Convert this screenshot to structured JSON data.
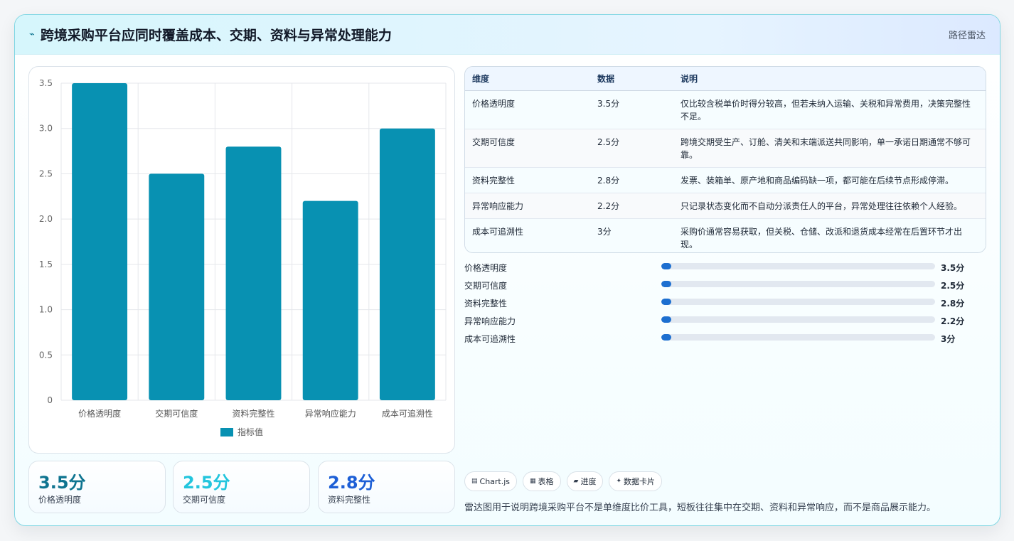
{
  "header": {
    "icon": "sparkline-icon",
    "title": "跨境采购平台应同时覆盖成本、交期、资料与异常处理能力",
    "tag": "路径雷达"
  },
  "chart_data": {
    "type": "bar",
    "categories": [
      "价格透明度",
      "交期可信度",
      "资料完整性",
      "异常响应能力",
      "成本可追溯性"
    ],
    "series": [
      {
        "name": "指标值",
        "values": [
          3.5,
          2.5,
          2.8,
          2.2,
          3.0
        ],
        "color": "#0891b2"
      }
    ],
    "ylim": [
      0,
      3.5
    ],
    "yticks": [
      "0",
      "0.5",
      "1.0",
      "1.5",
      "2.0",
      "2.5",
      "3.0",
      "3.5"
    ],
    "grid": true,
    "legend": "bottom"
  },
  "stats": [
    {
      "value": "3.5分",
      "label": "价格透明度",
      "color": "#0e7490"
    },
    {
      "value": "2.5分",
      "label": "交期可信度",
      "color": "#22c5dd"
    },
    {
      "value": "2.8分",
      "label": "资料完整性",
      "color": "#1d5fd6"
    }
  ],
  "table": {
    "headers": [
      "维度",
      "数据",
      "说明"
    ],
    "rows": [
      [
        "价格透明度",
        "3.5分",
        "仅比较含税单价时得分较高，但若未纳入运输、关税和异常费用，决策完整性不足。"
      ],
      [
        "交期可信度",
        "2.5分",
        "跨境交期受生产、订舱、清关和末端派送共同影响，单一承诺日期通常不够可靠。"
      ],
      [
        "资料完整性",
        "2.8分",
        "发票、装箱单、原产地和商品编码缺一项，都可能在后续节点形成停滞。"
      ],
      [
        "异常响应能力",
        "2.2分",
        "只记录状态变化而不自动分派责任人的平台，异常处理往往依赖个人经验。"
      ],
      [
        "成本可追溯性",
        "3分",
        "采购价通常容易获取，但关税、仓储、改派和退货成本经常在后置环节才出现。"
      ]
    ]
  },
  "progress": [
    {
      "label": "价格透明度",
      "value": "3.5分",
      "fraction": 0.035
    },
    {
      "label": "交期可信度",
      "value": "2.5分",
      "fraction": 0.025
    },
    {
      "label": "资料完整性",
      "value": "2.8分",
      "fraction": 0.028
    },
    {
      "label": "异常响应能力",
      "value": "2.2分",
      "fraction": 0.022
    },
    {
      "label": "成本可追溯性",
      "value": "3分",
      "fraction": 0.03
    }
  ],
  "chips": [
    {
      "icon": "chart-icon",
      "glyph": "▤",
      "label": "Chart.js"
    },
    {
      "icon": "table-icon",
      "glyph": "▦",
      "label": "表格"
    },
    {
      "icon": "progress-icon",
      "glyph": "▰",
      "label": "进度"
    },
    {
      "icon": "sparkle-icon",
      "glyph": "✦",
      "label": "数据卡片"
    }
  ],
  "note": "雷达图用于说明跨境采购平台不是单维度比价工具，短板往往集中在交期、资料和异常响应，而不是商品展示能力。"
}
